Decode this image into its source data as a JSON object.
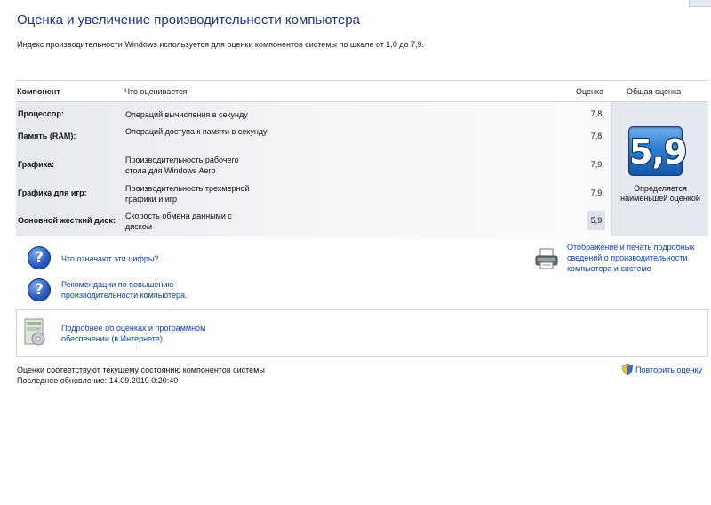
{
  "header": {
    "title": "Оценка и увеличение производительности компьютера",
    "intro": "Индекс производительности Windows используется для оценки компонентов системы по шкале от 1,0 до 7,9."
  },
  "table": {
    "headers": {
      "component": "Компонент",
      "what": "Что оценивается",
      "score": "Оценка",
      "overall": "Общая оценка"
    },
    "rows": [
      {
        "name": "Процессор:",
        "desc": "Операций вычисления в секунду",
        "value": "7,8"
      },
      {
        "name": "Память (RAM):",
        "desc": "Операций доступа к памяти в секунду",
        "value": "7,8"
      },
      {
        "name": "Графика:",
        "desc": "Производительность рабочего стола для Windows Aero",
        "value": "7,9"
      },
      {
        "name": "Графика для игр:",
        "desc": "Производительность трехмерной графики и игр",
        "value": "7,9"
      },
      {
        "name": "Основной жесткий диск:",
        "desc": "Скорость обмена данными с диском",
        "value": "5,9"
      }
    ],
    "overall": {
      "score": "5,9",
      "caption": "Определяется наименьшей оценкой"
    }
  },
  "links": {
    "what_numbers_mean": "Что означают эти цифры?",
    "recommendations": "Рекомендации по повышению производительности компьютера.",
    "print_details": "Отображение и печать подробных сведений о производительности компьютера и системе",
    "more_online": "Подробнее об оценках и программном обеспечении (в Интернете)",
    "rerun": "Повторить оценку"
  },
  "status": {
    "line1": "Оценки соответствуют текущему состоянию компонентов системы",
    "line2": "Последнее обновление: 14.09.2019 0:20:40"
  },
  "icons": {
    "help": "help-question-icon",
    "printer": "printer-icon",
    "software": "software-box-icon",
    "shield": "uac-shield-icon"
  },
  "colors": {
    "title": "#1e3287",
    "link": "#0b3fb8",
    "badge": "#2e7fd1"
  }
}
